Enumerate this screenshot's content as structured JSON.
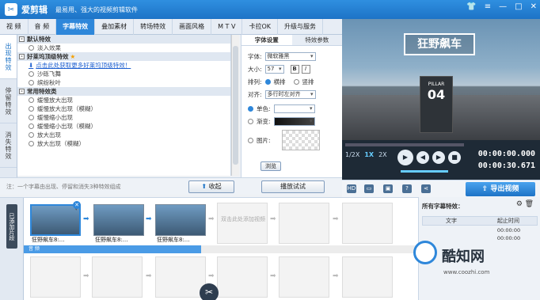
{
  "app": {
    "name": "爱剪辑",
    "slogan": "最易用、强大的视频剪辑软件"
  },
  "tabs": [
    {
      "label": "视  频"
    },
    {
      "label": "音  频"
    },
    {
      "label": "字幕特效"
    },
    {
      "label": "叠加素材"
    },
    {
      "label": "转场特效"
    },
    {
      "label": "画面风格"
    },
    {
      "label": "M T V"
    },
    {
      "label": "卡拉OK"
    },
    {
      "label": "升级与服务"
    }
  ],
  "vtabs": [
    {
      "label": "出现特效"
    },
    {
      "label": "停留特效"
    },
    {
      "label": "消失特效"
    }
  ],
  "effects": {
    "cat1": "默认特效",
    "cat1_items": [
      "淡入效果"
    ],
    "cat2": "好莱坞顶级特效",
    "cat2_link": "点击此处获取更多好莱坞顶级特效！",
    "cat2_items": [
      "沙砾飞舞",
      "缤纷秋叶"
    ],
    "cat3": "常用特效类",
    "cat3_items": [
      "缓慢放大出现",
      "缓慢放大出现（模糊）",
      "缓慢缩小出现",
      "缓慢缩小出现（模糊）",
      "放大出现",
      "放大出现（模糊）"
    ]
  },
  "note": "注：一个字幕由出现、停留和消失3种特效组成",
  "collapse_label": "收起",
  "preview_button": "播放试试",
  "settings": {
    "tabs": [
      "字体设置",
      "特效参数"
    ],
    "font_label": "字体:",
    "font_value": "微软雅黑",
    "size_label": "大小:",
    "size_value": "57",
    "bold": "B",
    "italic": "I",
    "layout_label": "排列:",
    "horizontal": "横排",
    "vertical": "竖排",
    "align_label": "对齐:",
    "align_value": "多行时左对齐",
    "color_label": "单色:",
    "gradient_label": "渐变:",
    "image_label": "图片:",
    "browse": "浏览"
  },
  "preview": {
    "caption": "狂野飙车",
    "pillar_top": "PILLAR",
    "pillar_num": "04"
  },
  "player": {
    "speeds": [
      "1/2X",
      "1X",
      "2X"
    ],
    "current_time": "00:00:00.000",
    "total_time": "00:00:30.671",
    "progress": 0.0
  },
  "export_label": "导出视频",
  "timeline": {
    "added_label": "已添加片段",
    "clips": [
      {
        "name": "狂野飙车8:..."
      },
      {
        "name": "狂野飙车8:..."
      },
      {
        "name": "狂野飙车8:..."
      }
    ],
    "add_slot_text": "双击此处添加视频",
    "audio_label": "音 频"
  },
  "subtitles": {
    "title": "所有字幕特效：",
    "columns": [
      "文字",
      "起止时间"
    ],
    "rows": [
      {
        "text": "",
        "time": "00:00:00"
      },
      {
        "text": "",
        "time": "00:00:00"
      }
    ]
  },
  "watermark": {
    "text": "酷知网",
    "url": "www.coozhi.com"
  }
}
